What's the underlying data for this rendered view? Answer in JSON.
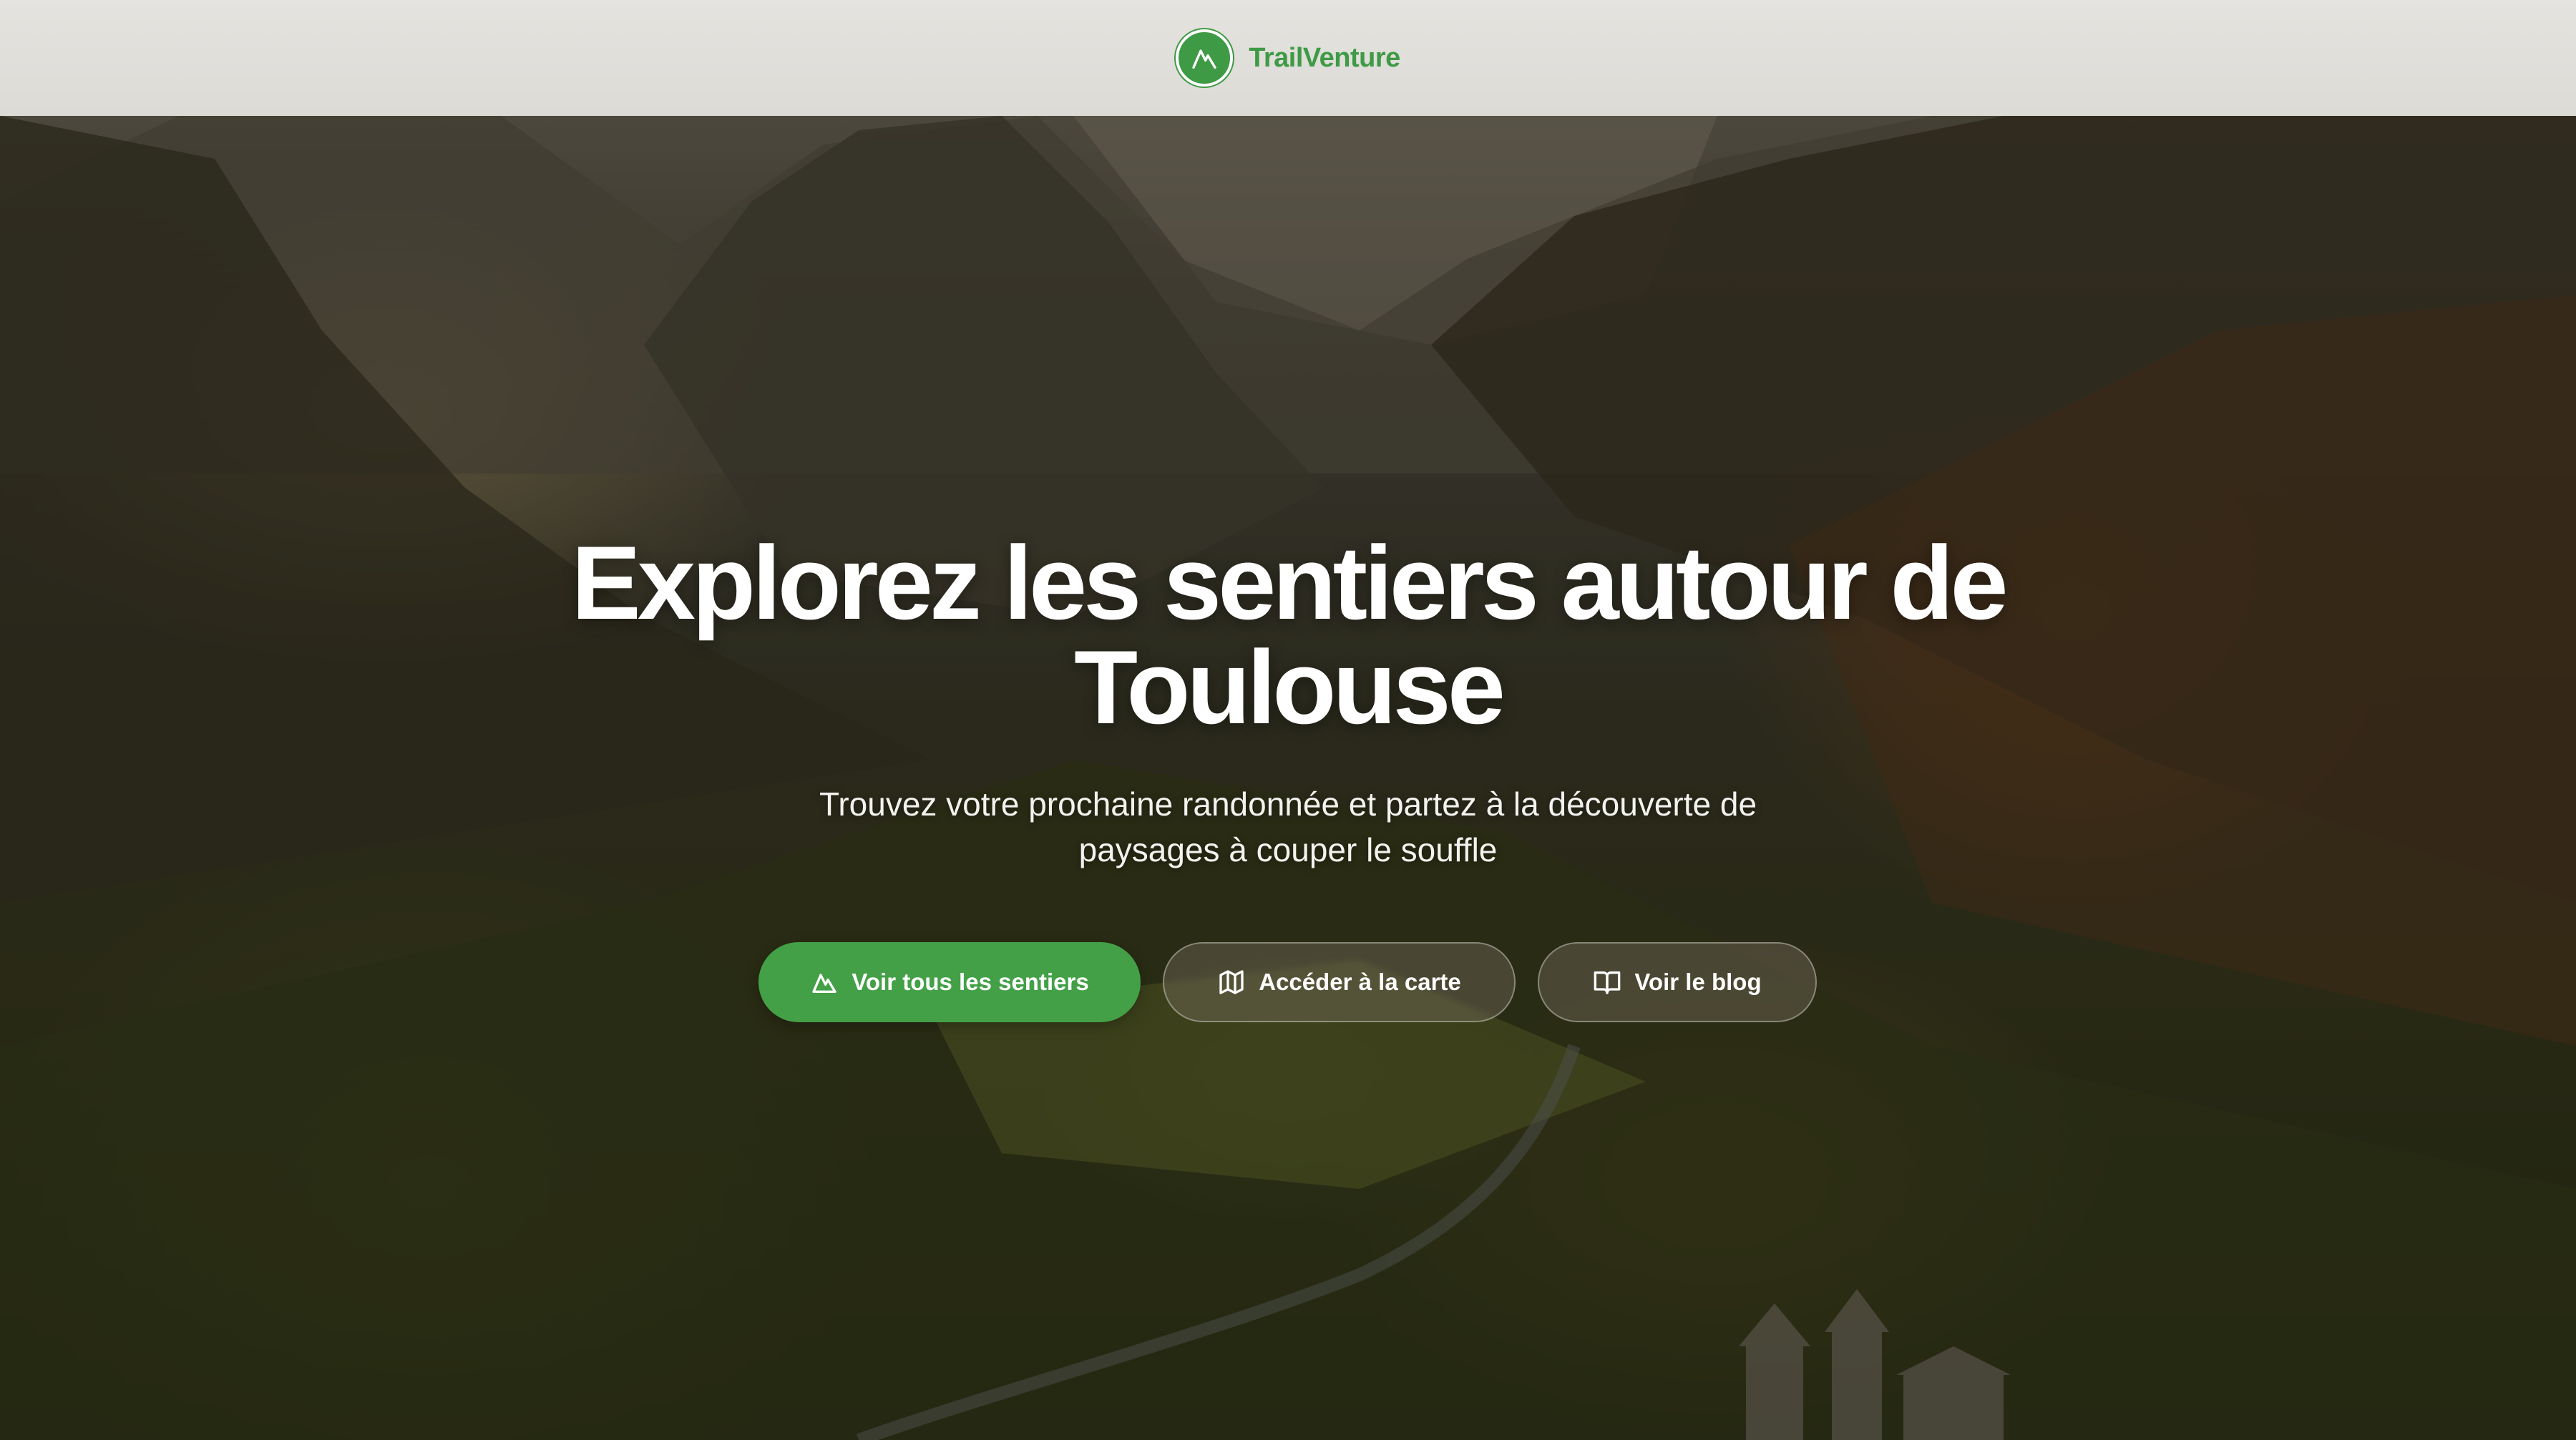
{
  "header": {
    "brand_name": "TrailVenture",
    "logo_icon": "mountain-icon",
    "brand_color": "#3f9a45"
  },
  "hero": {
    "title": "Explorez les sentiers autour de Toulouse",
    "subtitle": "Trouvez votre prochaine randonnée et partez à la découverte de paysages à couper le souffle",
    "buttons": [
      {
        "label": "Voir tous les sentiers",
        "icon": "mountain-icon",
        "style": "primary",
        "color": "#43a047"
      },
      {
        "label": "Accéder à la carte",
        "icon": "map-icon",
        "style": "secondary"
      },
      {
        "label": "Voir le blog",
        "icon": "book-open-icon",
        "style": "secondary"
      }
    ]
  }
}
